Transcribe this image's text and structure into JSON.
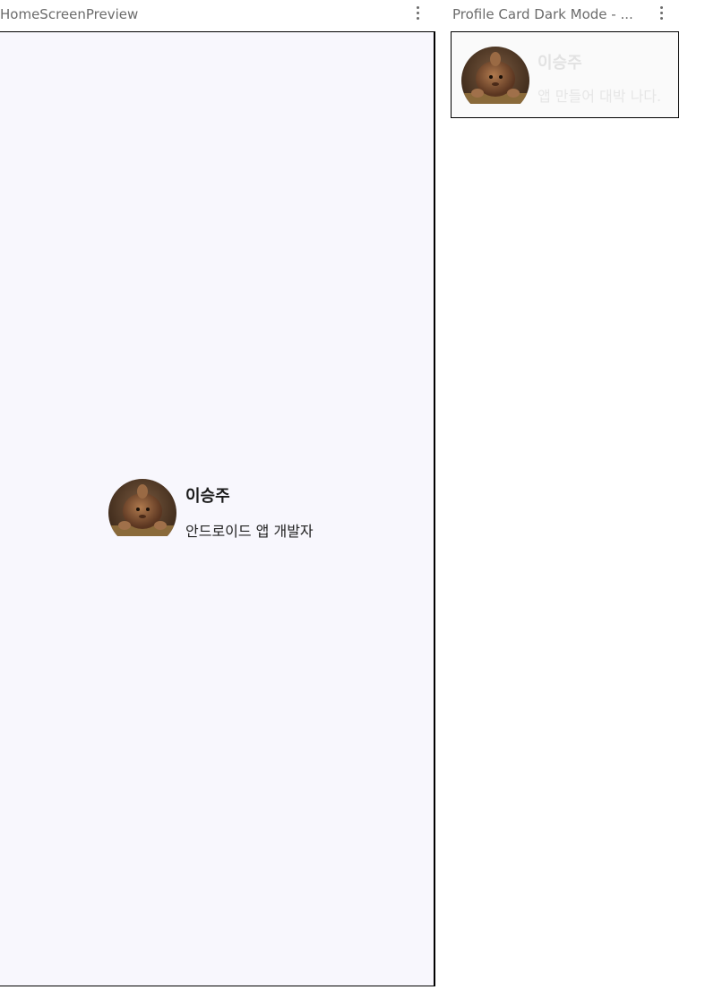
{
  "panels": {
    "home": {
      "title": "HomeScreenPreview",
      "profile": {
        "name": "이승주",
        "subtitle": "안드로이드 앱 개발자"
      },
      "colors": {
        "background": "#f8f7fd",
        "name": "#1a1a1a",
        "subtitle": "#222222"
      }
    },
    "dark": {
      "title": "Profile Card Dark Mode - ...",
      "profile": {
        "name": "이승주",
        "subtitle": "앱 만들어 대박 나다."
      },
      "colors": {
        "background": "#fafafa",
        "name": "#e2e2e2",
        "subtitle": "#e6e6e6"
      }
    }
  },
  "icons": {
    "menu": "more-vert-icon",
    "avatar": "profile-photo"
  }
}
